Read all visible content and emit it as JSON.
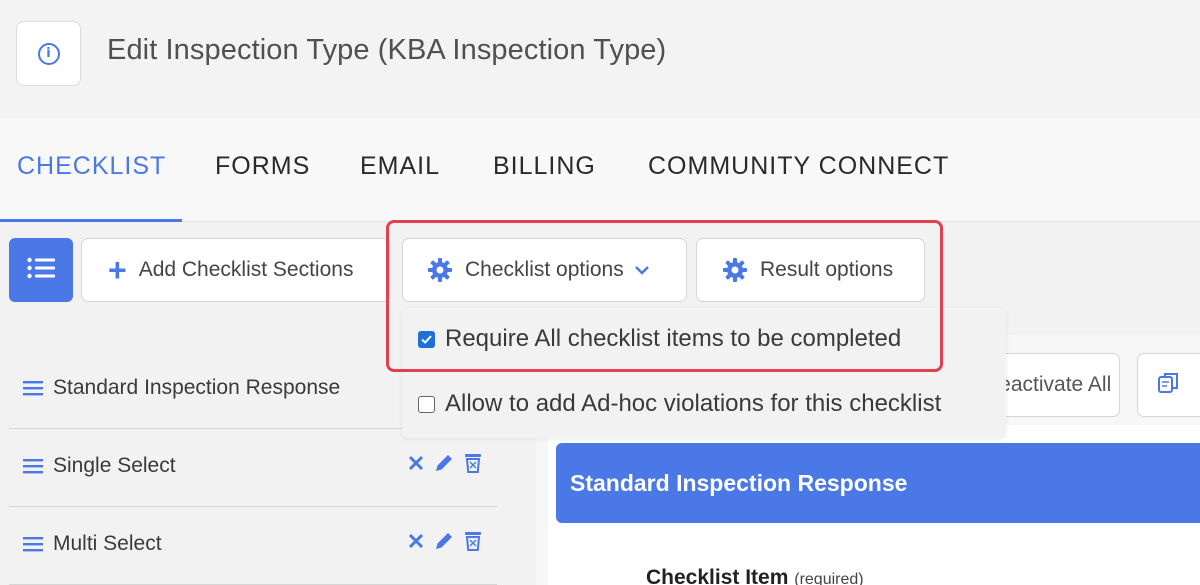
{
  "header": {
    "title": "Edit Inspection Type (KBA Inspection Type)",
    "info_icon": "info-icon"
  },
  "tabs": [
    {
      "label": "CHECKLIST",
      "active": true
    },
    {
      "label": "FORMS",
      "active": false
    },
    {
      "label": "EMAIL",
      "active": false
    },
    {
      "label": "BILLING",
      "active": false
    },
    {
      "label": "COMMUNITY CONNECT",
      "active": false
    }
  ],
  "toolbar": {
    "add_sections_label": "Add Checklist Sections",
    "checklist_options_label": "Checklist options",
    "result_options_label": "Result options"
  },
  "checklist_options_menu": [
    {
      "label": "Require All checklist items to be completed",
      "checked": true
    },
    {
      "label": "Allow to add Ad-hoc violations for this checklist",
      "checked": false
    }
  ],
  "sections": [
    {
      "label": "Standard Inspection Response"
    },
    {
      "label": "Single Select"
    },
    {
      "label": "Multi Select"
    }
  ],
  "right_panel": {
    "deactivate_label": "Deactivate All",
    "section_header": "Standard Inspection Response",
    "checklist_item_label": "Checklist Item",
    "required_label": "(required)"
  },
  "colors": {
    "accent": "#4a78e6",
    "highlight": "#e04050",
    "checkbox": "#1f6fd8"
  }
}
